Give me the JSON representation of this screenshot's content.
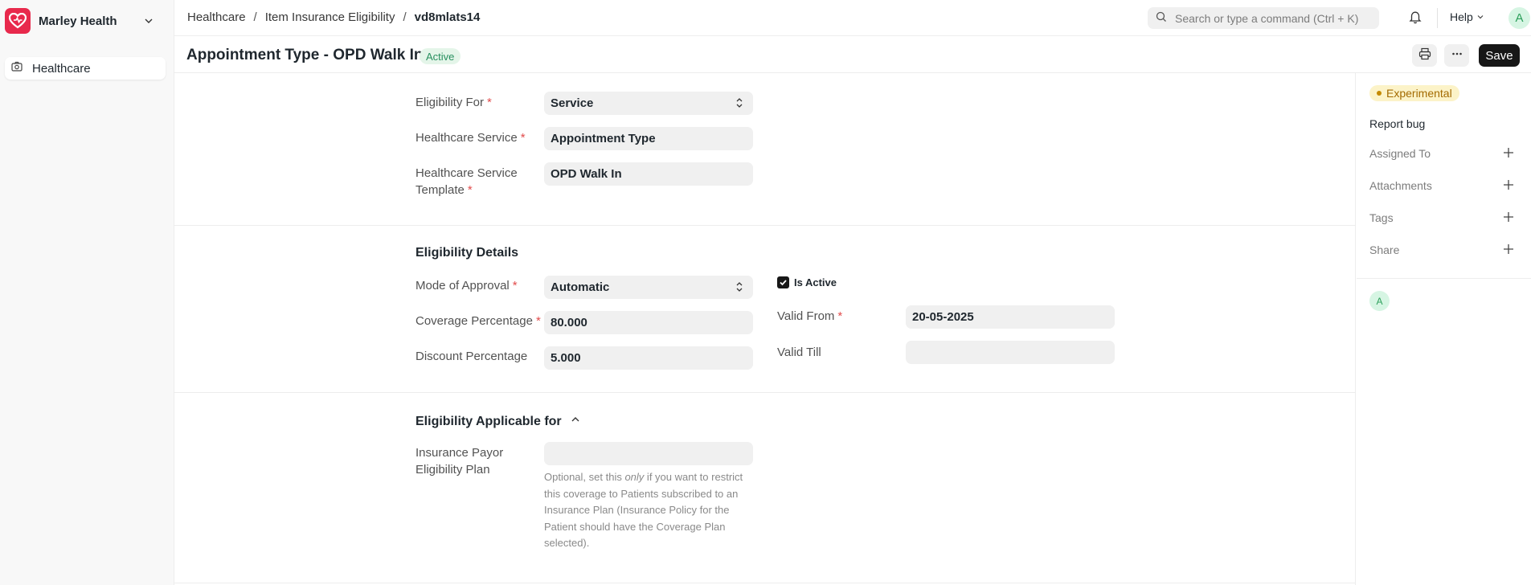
{
  "sidebar": {
    "brand": "Marley Health",
    "items": [
      {
        "label": "Healthcare",
        "icon": "workspace-icon"
      }
    ]
  },
  "topbar": {
    "breadcrumbs": [
      "Healthcare",
      "Item Insurance Eligibility",
      "vd8mlats14"
    ],
    "breadcrumb_separator": "/",
    "search_placeholder": "Search or type a command (Ctrl + K)",
    "help_label": "Help",
    "avatar_initial": "A"
  },
  "page": {
    "title": "Appointment Type - OPD Walk In",
    "status": "Active",
    "save_label": "Save"
  },
  "form": {
    "eligibility_for": {
      "label": "Eligibility For",
      "value": "Service"
    },
    "healthcare_service": {
      "label": "Healthcare Service",
      "value": "Appointment Type"
    },
    "service_template": {
      "label_line1": "Healthcare Service",
      "label_line2": "Template",
      "value": "OPD Walk In"
    },
    "details": {
      "title": "Eligibility Details",
      "mode_of_approval": {
        "label": "Mode of Approval",
        "value": "Automatic"
      },
      "coverage_percentage": {
        "label": "Coverage Percentage",
        "value": "80.000"
      },
      "discount_percentage": {
        "label": "Discount Percentage",
        "value": "5.000"
      },
      "is_active": {
        "label": "Is Active",
        "checked": true
      },
      "valid_from": {
        "label": "Valid From",
        "value": "20-05-2025"
      },
      "valid_till": {
        "label": "Valid Till",
        "value": ""
      }
    },
    "applicable": {
      "title": "Eligibility Applicable for",
      "payor_plan": {
        "label_line1": "Insurance Payor",
        "label_line2": "Eligibility Plan",
        "value": ""
      },
      "help_line1": "Optional, set this ",
      "help_em": "only",
      "help_line1_end": " if you want to",
      "help_rest": "restrict this coverage to Patients subscribed to an Insurance Plan (Insurance Policy for the Patient should have the Coverage Plan selected)."
    }
  },
  "right_panel": {
    "experimental": "Experimental",
    "report_bug": "Report bug",
    "rows": [
      "Assigned To",
      "Attachments",
      "Tags",
      "Share"
    ],
    "avatar_initial": "A"
  },
  "colors": {
    "accent_dark": "#171717",
    "brand": "#e8294c",
    "active_badge": "#e4f5e9",
    "required": "#e24c4c"
  }
}
